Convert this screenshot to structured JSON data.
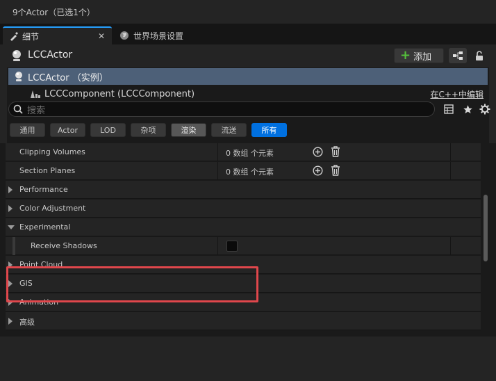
{
  "topbar": {
    "title": "9个Actor（已选1个）"
  },
  "tabs": [
    {
      "label": "细节",
      "icon": "details-icon",
      "closable": true
    },
    {
      "label": "世界场景设置",
      "icon": "globe-icon"
    }
  ],
  "actor": {
    "name": "LCCActor",
    "add_label": "添加"
  },
  "tree": {
    "root_label": "LCCActor （实例）",
    "child_label": "LCCComponent (LCCComponent)",
    "edit_link": "在C++中编辑"
  },
  "search": {
    "placeholder": "搜索"
  },
  "filters": [
    "通用",
    "Actor",
    "LOD",
    "杂项",
    "渲染",
    "流送",
    "所有"
  ],
  "filters_state": {
    "selected": "渲染",
    "active": "所有"
  },
  "properties": {
    "clipping_volumes": {
      "label": "Clipping Volumes",
      "value": "0 数组 个元素"
    },
    "section_planes": {
      "label": "Section Planes",
      "value": "0 数组 个元素"
    },
    "cat_performance": "Performance",
    "cat_color": "Color Adjustment",
    "cat_experimental": "Experimental",
    "receive_shadows": {
      "label": "Receive Shadows",
      "checked": false
    },
    "cat_pointcloud": "Point Cloud",
    "cat_gis": "GIS",
    "cat_animation": "Animation",
    "cat_advanced": "高级"
  },
  "colors": {
    "accent": "#0070e0",
    "highlight": "#e0474c",
    "selected_row": "#4d6078",
    "add_plus": "#55c23b"
  }
}
